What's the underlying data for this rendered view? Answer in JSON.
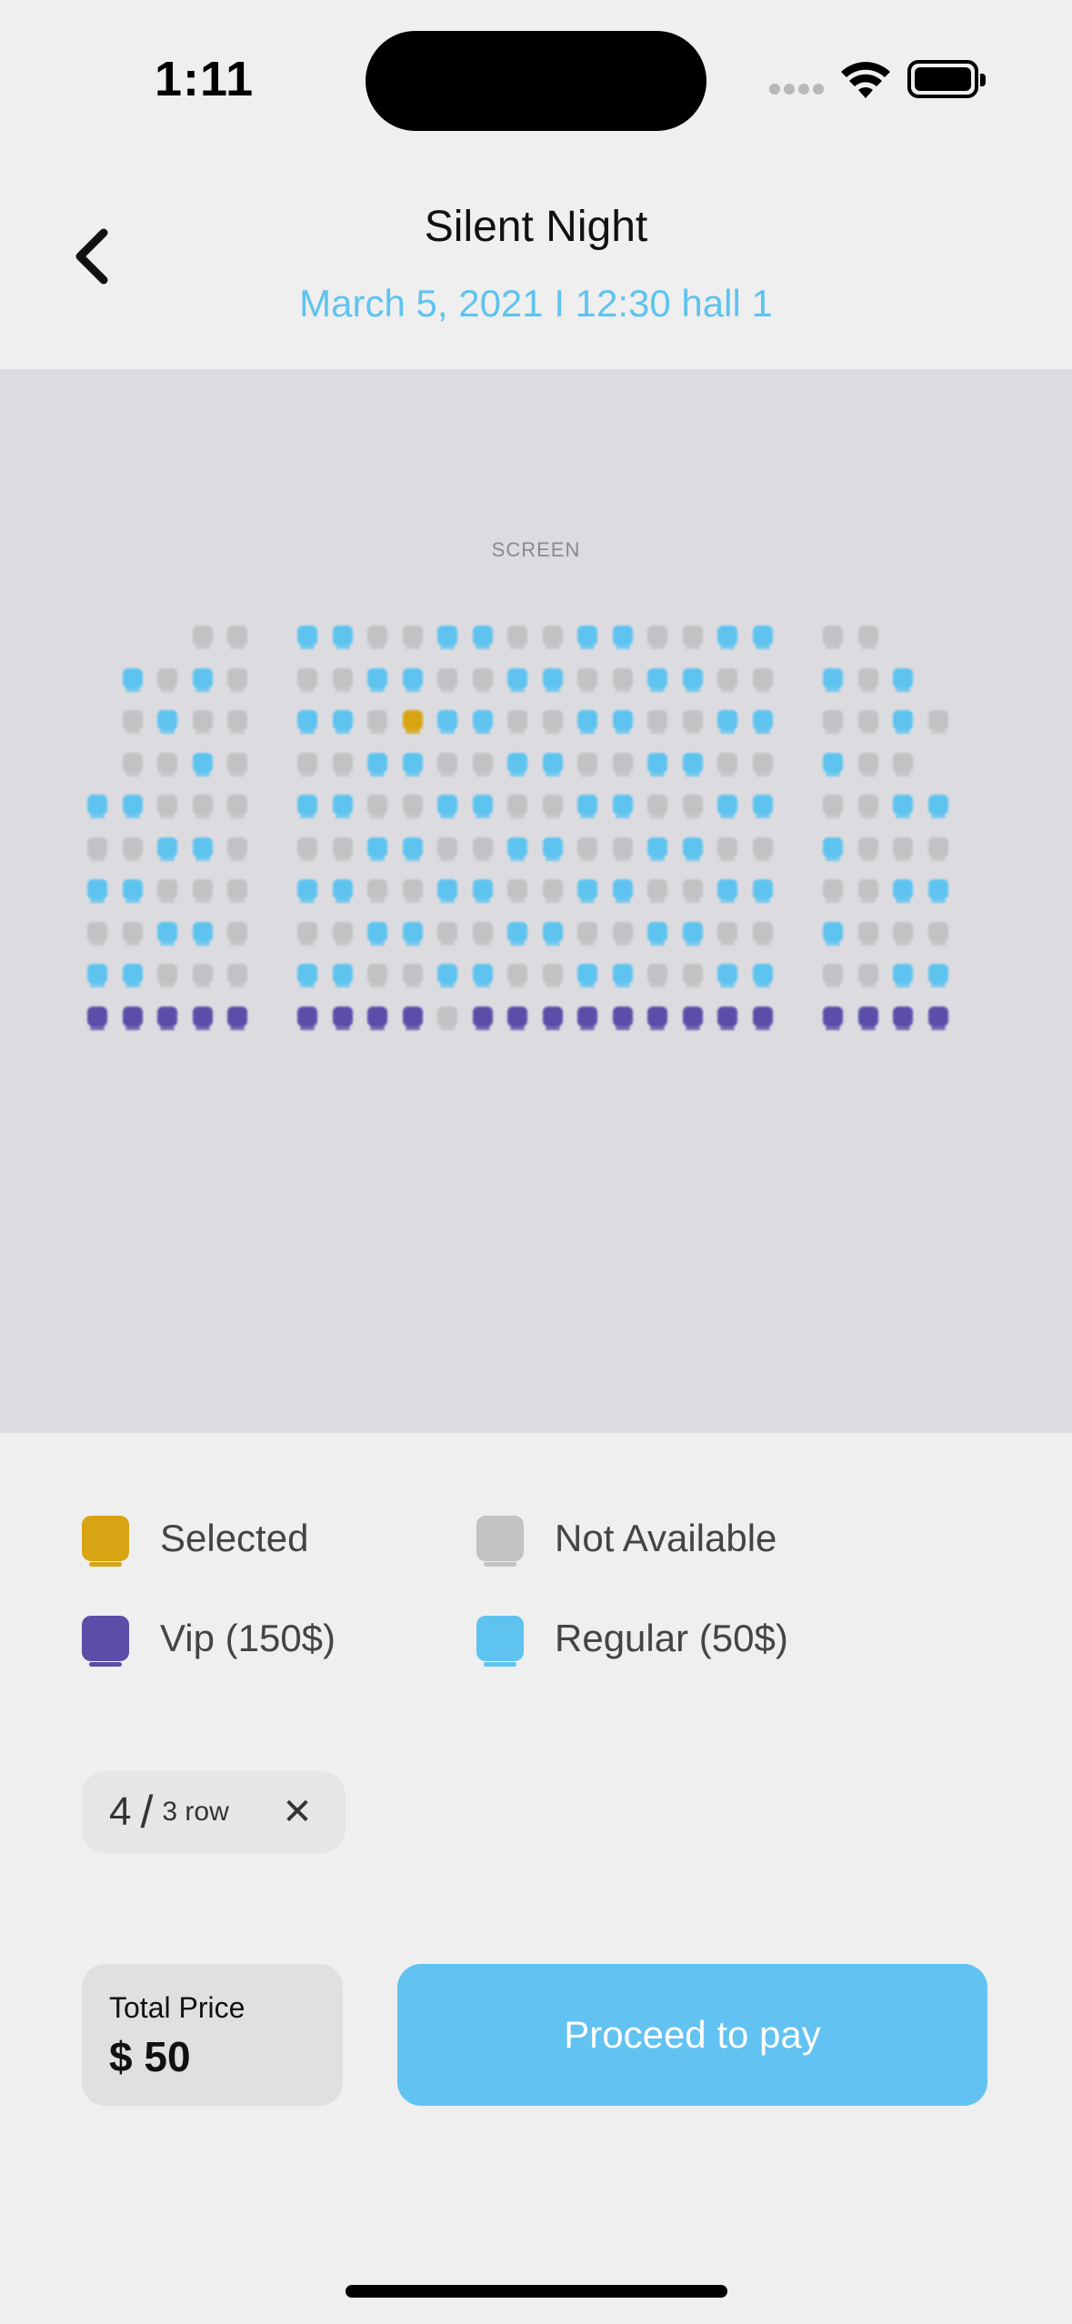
{
  "status_bar": {
    "time": "1:11"
  },
  "header": {
    "title": "Silent Night",
    "showtime": "March 5, 2021 I 12:30 hall 1"
  },
  "screen_label": "SCREEN",
  "colors": {
    "selected": "#d9a414",
    "unavailable": "#c2c2c4",
    "vip": "#5a4ea8",
    "regular": "#5ec3ef",
    "accent": "#62c2f1"
  },
  "seat_map": {
    "legend_codes": {
      "S": "selected",
      "N": "unavailable",
      "V": "vip",
      "R": "regular",
      "E": "empty"
    },
    "rows": [
      [
        "__",
        "__",
        "__",
        "NN",
        "NN",
        "RR",
        "RR",
        "NN",
        "NN",
        "RR",
        "RR",
        "NN",
        "NN",
        "RR",
        "RR",
        "NN",
        "NN",
        "RR",
        "RR",
        "NN",
        "NN",
        "__",
        "__"
      ],
      [
        "__",
        "RR",
        "NN",
        "RR",
        "NN",
        "NN",
        "NN",
        "RR",
        "RR",
        "NN",
        "NN",
        "RR",
        "RR",
        "NN",
        "NN",
        "RR",
        "RR",
        "NN",
        "NN",
        "RR",
        "NN",
        "RR",
        "__"
      ],
      [
        "__",
        "NN",
        "RR",
        "NN",
        "NN",
        "RR",
        "RR",
        "NN",
        "SS",
        "RR",
        "RR",
        "NN",
        "NN",
        "RR",
        "RR",
        "NN",
        "NN",
        "RR",
        "RR",
        "NN",
        "NN",
        "RR",
        "NN"
      ],
      [
        "__",
        "NN",
        "NN",
        "RR",
        "NN",
        "NN",
        "NN",
        "RR",
        "RR",
        "NN",
        "NN",
        "RR",
        "RR",
        "NN",
        "NN",
        "RR",
        "RR",
        "NN",
        "NN",
        "RR",
        "NN",
        "NN",
        "__"
      ],
      [
        "RR",
        "RR",
        "NN",
        "NN",
        "NN",
        "RR",
        "RR",
        "NN",
        "NN",
        "RR",
        "RR",
        "NN",
        "NN",
        "RR",
        "RR",
        "NN",
        "NN",
        "RR",
        "RR",
        "NN",
        "NN",
        "RR",
        "RR"
      ],
      [
        "NN",
        "NN",
        "RR",
        "RR",
        "NN",
        "NN",
        "NN",
        "RR",
        "RR",
        "NN",
        "NN",
        "RR",
        "RR",
        "NN",
        "NN",
        "RR",
        "RR",
        "NN",
        "NN",
        "RR",
        "NN",
        "NN",
        "NN"
      ],
      [
        "RR",
        "RR",
        "NN",
        "NN",
        "NN",
        "RR",
        "RR",
        "NN",
        "NN",
        "RR",
        "RR",
        "NN",
        "NN",
        "RR",
        "RR",
        "NN",
        "NN",
        "RR",
        "RR",
        "NN",
        "NN",
        "RR",
        "RR"
      ],
      [
        "NN",
        "NN",
        "RR",
        "RR",
        "NN",
        "NN",
        "NN",
        "RR",
        "RR",
        "NN",
        "NN",
        "RR",
        "RR",
        "NN",
        "NN",
        "RR",
        "RR",
        "NN",
        "NN",
        "RR",
        "NN",
        "NN",
        "NN"
      ],
      [
        "RR",
        "RR",
        "NN",
        "NN",
        "NN",
        "RR",
        "RR",
        "NN",
        "NN",
        "RR",
        "RR",
        "NN",
        "NN",
        "RR",
        "RR",
        "NN",
        "NN",
        "RR",
        "RR",
        "NN",
        "NN",
        "RR",
        "RR"
      ],
      [
        "VV",
        "VV",
        "VV",
        "VV",
        "VV",
        "VV",
        "VV",
        "VV",
        "VV",
        "NN",
        "VV",
        "VV",
        "VV",
        "VV",
        "VV",
        "VV",
        "VV",
        "VV",
        "VV",
        "VV",
        "VV",
        "VV",
        "VV"
      ]
    ]
  },
  "legend": {
    "selected": "Selected",
    "not_available": "Not Available",
    "vip": "Vip (150$)",
    "regular": "Regular (50$)"
  },
  "selection_chip": {
    "seat": "4",
    "row": "3 row",
    "close_icon": "close-icon"
  },
  "total": {
    "label": "Total Price",
    "value": "$ 50"
  },
  "pay_button": {
    "label": "Proceed to pay"
  }
}
